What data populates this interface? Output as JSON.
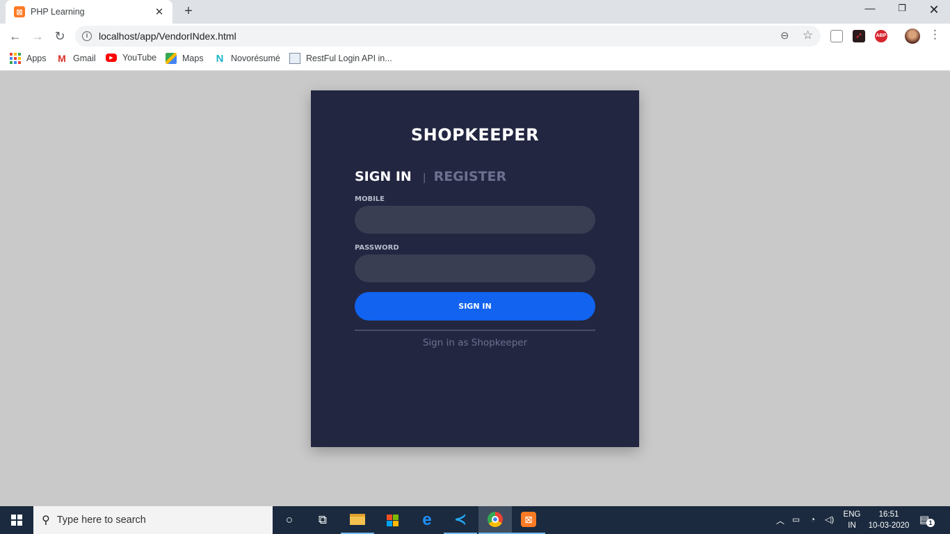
{
  "browser": {
    "tab": {
      "title": "PHP Learning",
      "favicon": "xampp-icon",
      "close": "✕"
    },
    "new_tab": "+",
    "window_controls": {
      "minimize": "—",
      "maximize": "❐",
      "close": "✕"
    },
    "url": "localhost/app/VendorINdex.html",
    "bookmarks": [
      {
        "label": "Apps",
        "icon": "apps-grid-icon"
      },
      {
        "label": "Gmail",
        "icon": "gmail-icon"
      },
      {
        "label": "YouTube",
        "icon": "youtube-icon"
      },
      {
        "label": "Maps",
        "icon": "maps-icon"
      },
      {
        "label": "Novorésumé",
        "icon": "novoresume-icon"
      },
      {
        "label": "RestFul Login API in...",
        "icon": "page-icon"
      }
    ],
    "extensions": {
      "abp": "ABP"
    }
  },
  "page": {
    "brand": "SHOPKEEPER",
    "tabs": {
      "signin": "SIGN IN",
      "separator": "|",
      "register": "REGISTER"
    },
    "mobile_label": "MOBILE",
    "mobile_value": "",
    "password_label": "PASSWORD",
    "password_value": "",
    "signin_button": "SIGN IN",
    "alt_link": "Sign in as Shopkeeper",
    "colors": {
      "background": "#c9c9c9",
      "card": "#222641",
      "input": "#3a3e52",
      "button": "#1163f0",
      "muted_text": "#6d7190"
    }
  },
  "taskbar": {
    "search_placeholder": "Type here to search",
    "lang_top": "ENG",
    "lang_bottom": "IN",
    "time": "16:51",
    "date": "10-03-2020",
    "notification_count": "1"
  }
}
